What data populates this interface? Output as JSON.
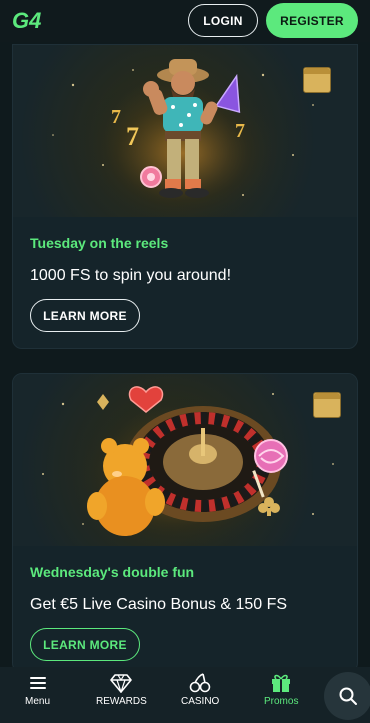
{
  "header": {
    "logo_text": "G4",
    "login_label": "LOGIN",
    "register_label": "REGISTER"
  },
  "promos": [
    {
      "kicker": "Tuesday on the reels",
      "title": "1000 FS to spin you around!",
      "button_label": "LEARN MORE",
      "image": "cowboy-slot-character-illustration"
    },
    {
      "kicker": "Wednesday's double fun",
      "title": "Get €5 Live Casino Bonus & 150 FS",
      "button_label": "LEARN MORE",
      "image": "roulette-wheel-gummy-bear-illustration"
    }
  ],
  "bottom_nav": {
    "items": [
      {
        "label": "Menu",
        "icon": "hamburger-icon"
      },
      {
        "label": "REWARDS",
        "icon": "diamond-icon"
      },
      {
        "label": "CASINO",
        "icon": "cherries-icon"
      },
      {
        "label": "Promos",
        "icon": "gift-icon"
      }
    ],
    "search_icon": "search-icon",
    "active": "Promos"
  },
  "colors": {
    "accent": "#5ce97d",
    "background": "#0f1a1d",
    "card": "#15242a"
  }
}
